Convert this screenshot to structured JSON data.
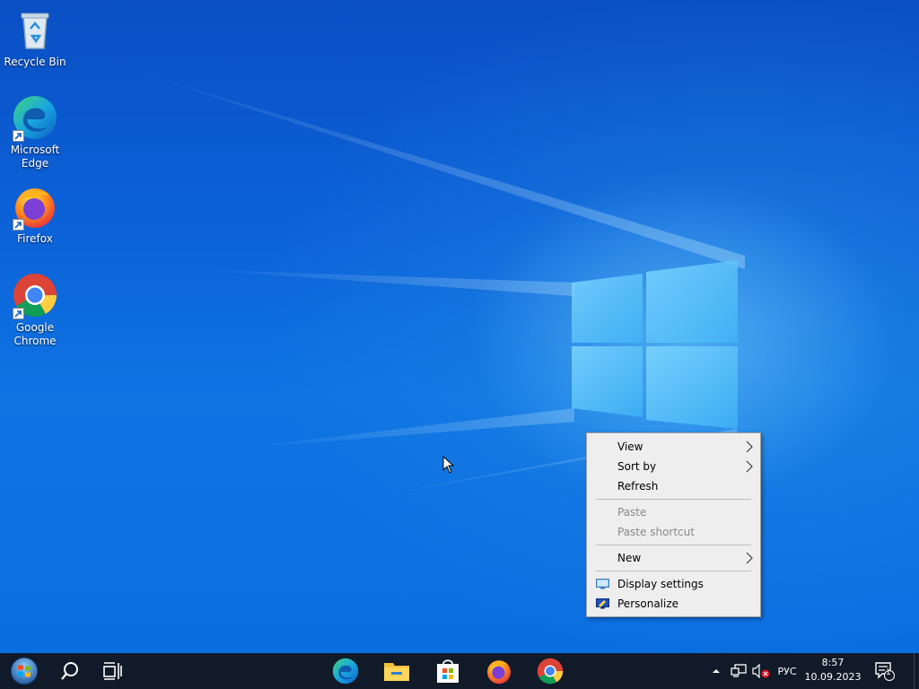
{
  "desktop": {
    "icons": [
      {
        "label_lines": [
          "Recycle Bin"
        ],
        "icon": "recycle-bin-icon"
      },
      {
        "label_lines": [
          "Microsoft",
          "Edge"
        ],
        "icon": "edge-icon"
      },
      {
        "label_lines": [
          "Firefox"
        ],
        "icon": "firefox-icon"
      },
      {
        "label_lines": [
          "Google",
          "Chrome"
        ],
        "icon": "chrome-icon"
      }
    ]
  },
  "context_menu": {
    "items": [
      {
        "label": "View",
        "submenu": true,
        "enabled": true
      },
      {
        "label": "Sort by",
        "submenu": true,
        "enabled": true
      },
      {
        "label": "Refresh",
        "submenu": false,
        "enabled": true
      },
      {
        "label": "Paste",
        "submenu": false,
        "enabled": false
      },
      {
        "label": "Paste shortcut",
        "submenu": false,
        "enabled": false
      },
      {
        "label": "New",
        "submenu": true,
        "enabled": true
      },
      {
        "label": "Display settings",
        "submenu": false,
        "enabled": true,
        "icon": "display-icon"
      },
      {
        "label": "Personalize",
        "submenu": false,
        "enabled": true,
        "icon": "personalize-icon"
      }
    ]
  },
  "taskbar": {
    "buttons": [
      "start-icon",
      "search-icon",
      "task-view-icon"
    ],
    "pinned": [
      "edge-icon",
      "file-explorer-icon",
      "store-icon",
      "firefox-icon",
      "chrome-icon"
    ],
    "tray": {
      "language": "РУС",
      "time": "8:57",
      "date": "10.09.2023",
      "notifications_count": "1"
    }
  },
  "colors": {
    "taskbar": "#101a28",
    "menu_bg": "#eeeeee",
    "desktop_blue": "#0c62d8"
  }
}
